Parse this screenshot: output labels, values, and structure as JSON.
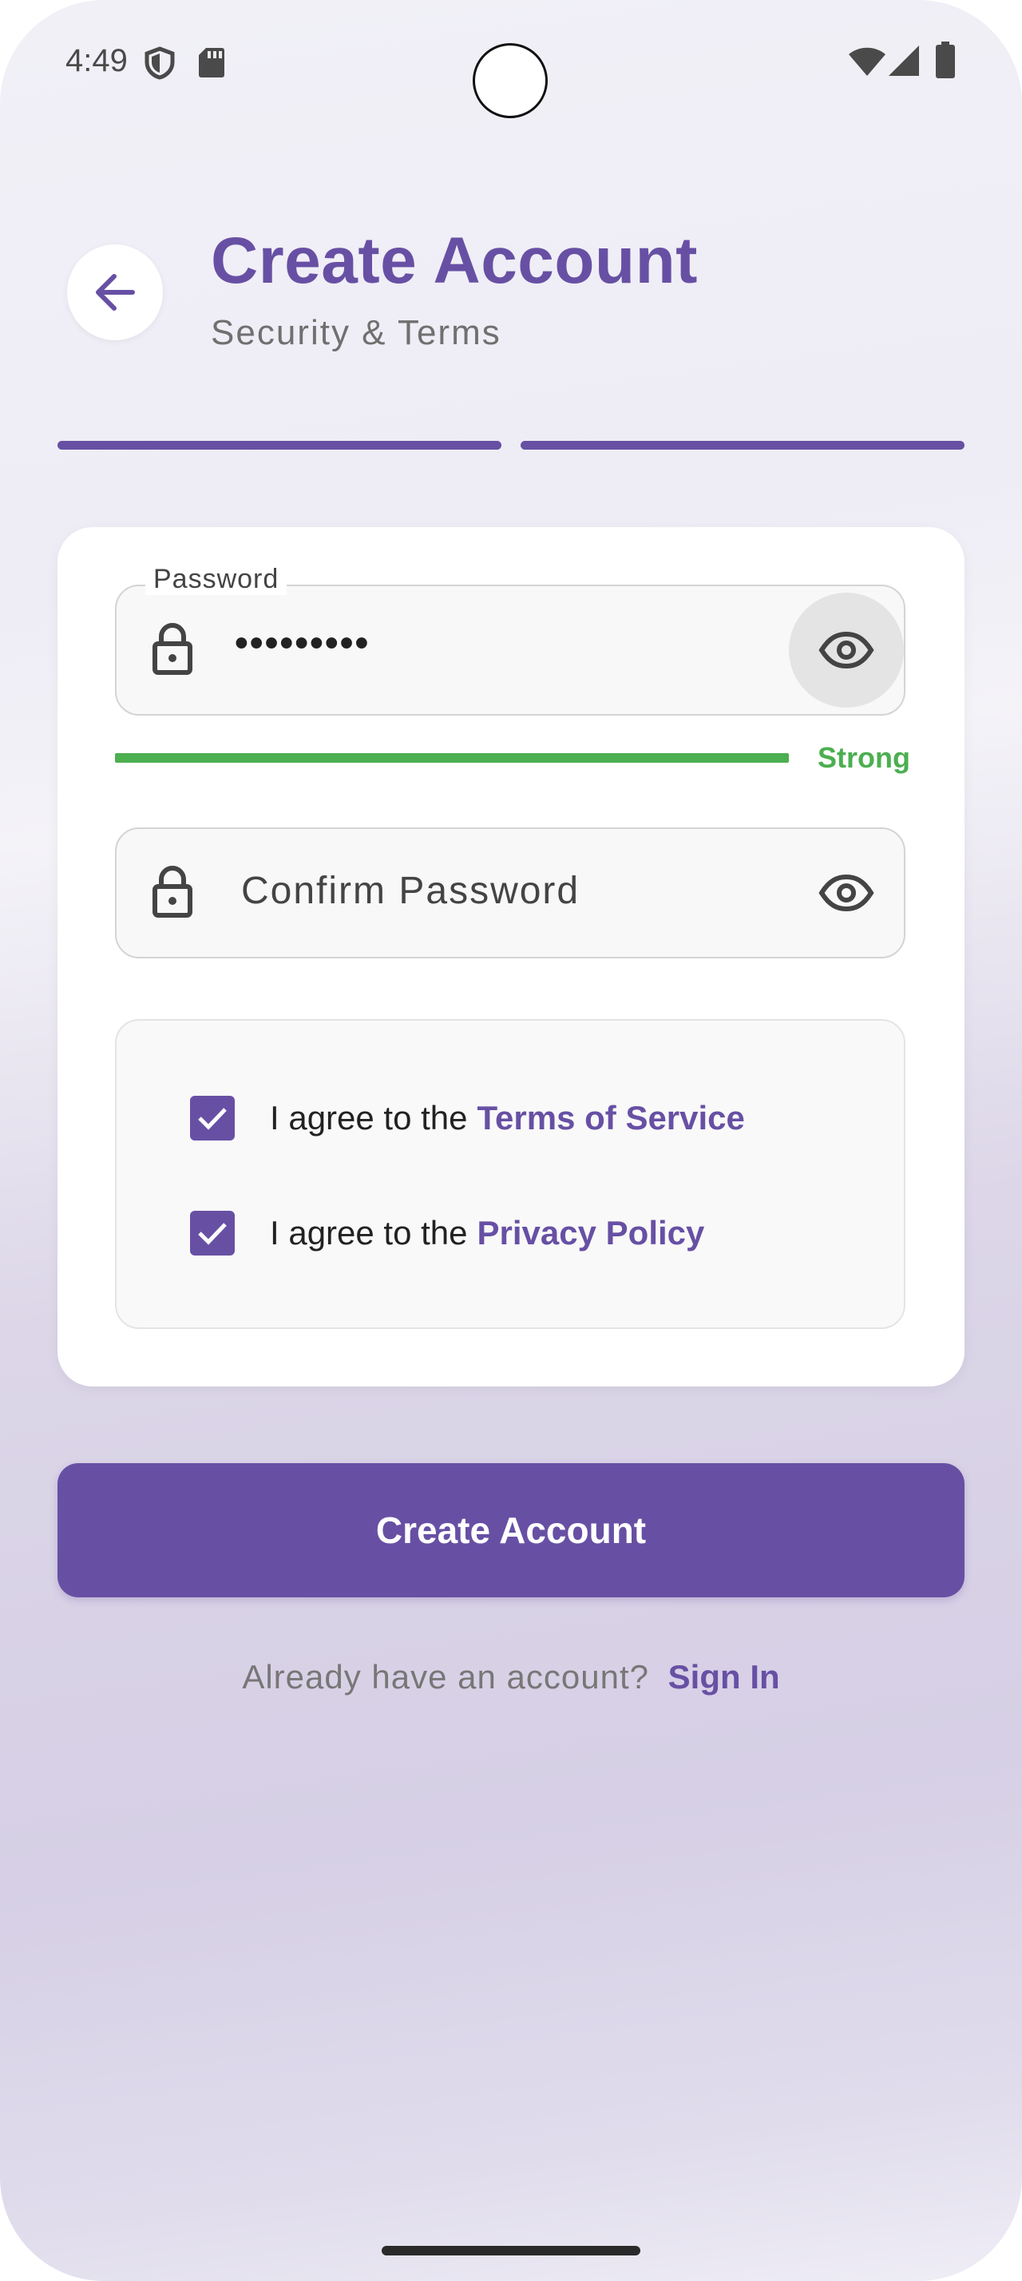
{
  "status_bar": {
    "time": "4:49"
  },
  "header": {
    "title": "Create Account",
    "subtitle": "Security & Terms"
  },
  "progress": {
    "steps_completed": 2,
    "steps_total": 2
  },
  "form": {
    "password": {
      "label": "Password",
      "value": "•••••••••",
      "strength_label": "Strong",
      "strength_level": 1.0
    },
    "confirm_password": {
      "placeholder": "Confirm Password",
      "value": ""
    },
    "agreements": [
      {
        "prefix": "I agree to the ",
        "link": "Terms of Service",
        "checked": true
      },
      {
        "prefix": "I agree to the ",
        "link": "Privacy Policy",
        "checked": true
      }
    ]
  },
  "actions": {
    "create_label": "Create Account",
    "signin_prompt": "Already have an account?",
    "signin_link": "Sign In"
  },
  "colors": {
    "accent": "#6750a4",
    "strength_strong": "#4caf50"
  },
  "icons": [
    "shield-icon",
    "sd-card-icon",
    "wifi-icon",
    "signal-icon",
    "battery-icon",
    "arrow-back-icon",
    "lock-icon",
    "eye-icon",
    "check-icon"
  ]
}
